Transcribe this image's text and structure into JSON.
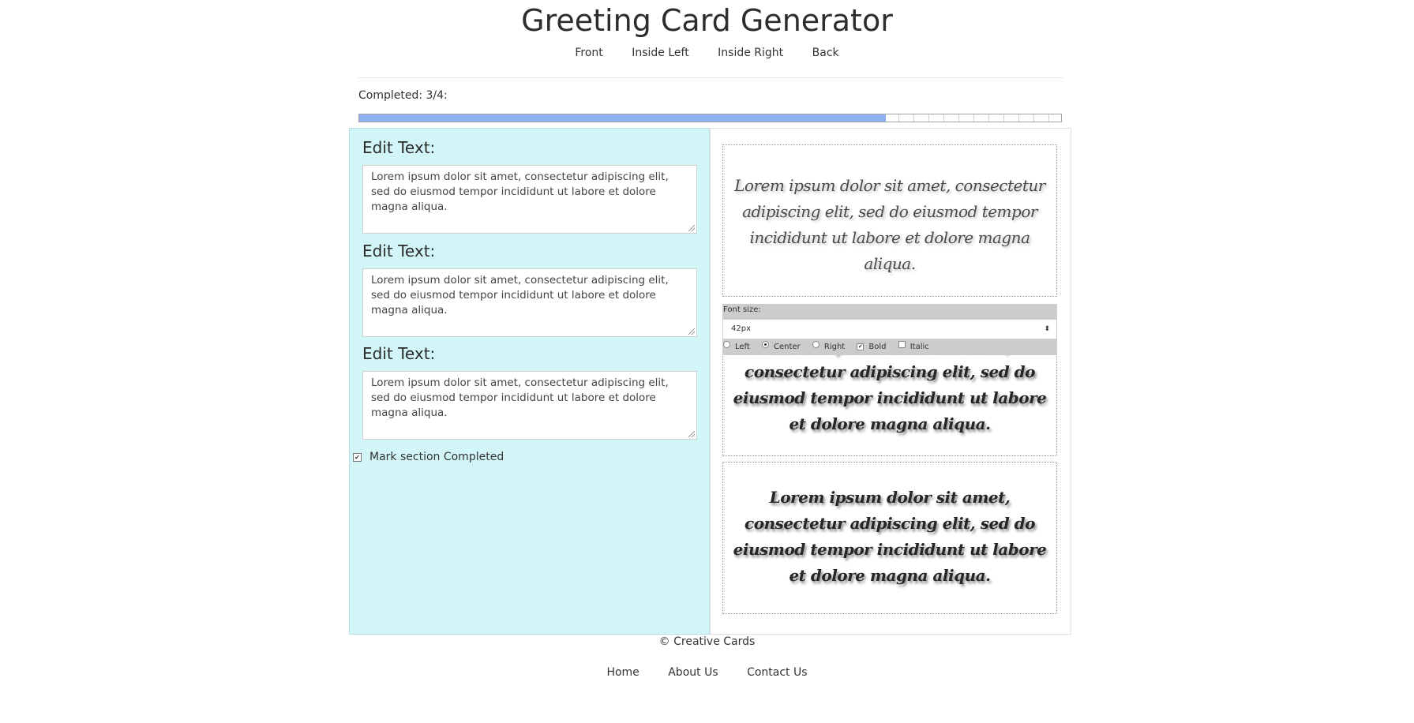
{
  "header": {
    "title": "Greeting Card Generator",
    "sections": [
      "Front",
      "Inside Left",
      "Inside Right",
      "Back"
    ]
  },
  "progress": {
    "label": "Completed: 3/4:",
    "fraction": 0.75,
    "fill_color": "#8fb2f0"
  },
  "editor": {
    "fields": [
      {
        "label": "Edit Text:",
        "value": "Lorem ipsum dolor sit amet, consectetur adipiscing elit, sed do eiusmod tempor incididunt ut labore et dolore magna aliqua."
      },
      {
        "label": "Edit Text:",
        "value": "Lorem ipsum dolor sit amet, consectetur adipiscing elit, sed do eiusmod tempor incididunt ut labore et dolore magna aliqua."
      },
      {
        "label": "Edit Text:",
        "value": "Lorem ipsum dolor sit amet, consectetur adipiscing elit, sed do eiusmod tempor incididunt ut labore et dolore magna aliqua."
      }
    ],
    "mark_completed_label": "Mark section Completed",
    "mark_completed_checked": true,
    "panel_color": "#d2f6f8"
  },
  "preview": {
    "blocks": [
      {
        "text": "Lorem ipsum dolor sit amet, consectetur adipiscing elit, sed do eiusmod tempor incididunt ut labore et dolore magna aliqua.",
        "bold": false
      },
      {
        "text": "Lorem ipsum dolor sit amet, consectetur adipiscing elit, sed do eiusmod tempor incididunt ut labore et dolore magna aliqua.",
        "bold": true
      },
      {
        "text": "Lorem ipsum dolor sit amet, consectetur adipiscing elit, sed do eiusmod tempor incididunt ut labore et dolore magna aliqua.",
        "bold": true
      }
    ],
    "toolbar": {
      "font_size_label": "Font size:",
      "font_size_value": "42px",
      "select_arrows": "⬍",
      "align_left": "Left",
      "align_center": "Center",
      "align_right": "Right",
      "bold": "Bold",
      "italic": "Italic",
      "selected_align": "Center",
      "bold_checked": true,
      "italic_checked": false
    }
  },
  "footer": {
    "copyright": "© Creative Cards",
    "links": [
      "Home",
      "About Us",
      "Contact Us"
    ]
  }
}
